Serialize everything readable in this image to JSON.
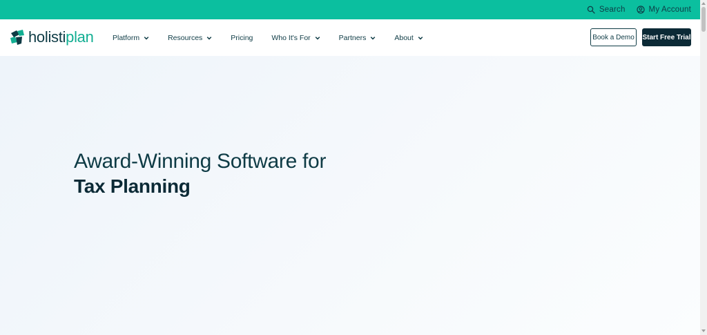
{
  "topbar": {
    "search_label": "Search",
    "account_label": "My Account",
    "search_icon": "search-icon",
    "account_icon": "user-circle-icon"
  },
  "logo": {
    "text_part1": "holisti",
    "text_part2": "plan",
    "icon": "holistiplan-logo-mark"
  },
  "nav": {
    "items": [
      {
        "label": "Platform",
        "dropdown": true
      },
      {
        "label": "Resources",
        "dropdown": true
      },
      {
        "label": "Pricing",
        "dropdown": false
      },
      {
        "label": "Who It's For",
        "dropdown": true
      },
      {
        "label": "Partners",
        "dropdown": true
      },
      {
        "label": "About",
        "dropdown": true
      }
    ]
  },
  "buttons": {
    "demo_label": "Book a Demo",
    "trial_label": "Start Free Trial"
  },
  "hero": {
    "line1": "Award-Winning Software for",
    "line2": "Tax Planning"
  },
  "colors": {
    "topbar": "#0bbf9f",
    "brand_dark": "#0e3b45",
    "brand_teal": "#12ae92",
    "cta_bg": "#0c2a36"
  }
}
